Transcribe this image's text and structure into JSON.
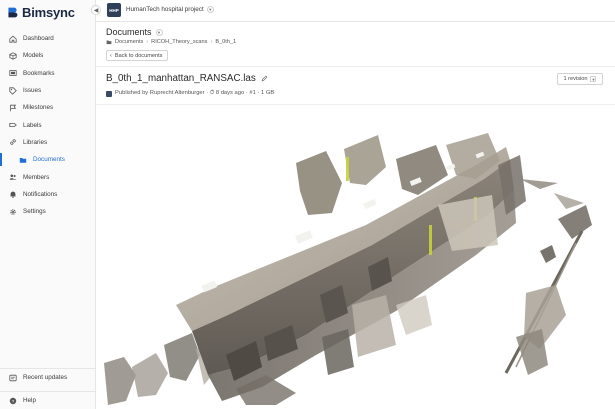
{
  "brand": {
    "name": "Bimsync"
  },
  "sidebar": {
    "items": [
      {
        "label": "Dashboard",
        "icon": "home-icon"
      },
      {
        "label": "Models",
        "icon": "cube-icon"
      },
      {
        "label": "Bookmarks",
        "icon": "bookmark-icon"
      },
      {
        "label": "Issues",
        "icon": "tag-icon"
      },
      {
        "label": "Milestones",
        "icon": "flag-icon"
      },
      {
        "label": "Labels",
        "icon": "label-icon"
      },
      {
        "label": "Libraries",
        "icon": "link-icon"
      },
      {
        "label": "Documents",
        "icon": "folder-icon"
      },
      {
        "label": "Members",
        "icon": "people-icon"
      },
      {
        "label": "Notifications",
        "icon": "bell-icon"
      },
      {
        "label": "Settings",
        "icon": "gear-icon"
      }
    ],
    "recent_updates": "Recent updates",
    "help": "Help"
  },
  "topbar": {
    "project_initials": "HHP",
    "project_name": "HumanTech hospital project"
  },
  "header": {
    "title": "Documents",
    "breadcrumb": [
      "Documents",
      "RICOH_Theory_scans",
      "B_0th_1"
    ],
    "back_label": "Back to documents"
  },
  "file": {
    "name": "B_0th_1_manhattan_RANSAC.las",
    "meta": "Published by Ruprecht Altenburger · ⏱ 8 days ago · #1 · 1 GB",
    "revision_label": "1 revision"
  },
  "colors": {
    "accent": "#1f6fd6",
    "brand_dark": "#1a2a44"
  }
}
